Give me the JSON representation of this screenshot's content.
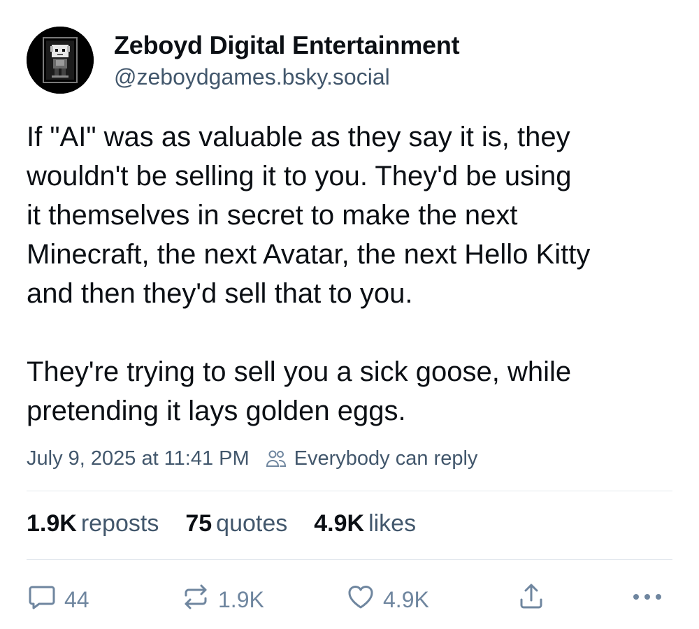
{
  "author": {
    "display_name": "Zeboyd Digital Entertainment",
    "handle": "@zeboydgames.bsky.social"
  },
  "post": {
    "paragraphs": [
      "If \"AI\" was as valuable as they say it is, they\nwouldn't be selling it to you. They'd be using\nit themselves in secret to make the next\nMinecraft, the next Avatar, the next Hello Kitty\nand then they'd sell that to you.",
      "They're trying to sell you a sick goose, while\npretending it lays golden eggs."
    ],
    "timestamp": "July 9, 2025 at 11:41 PM",
    "reply_setting": "Everybody can reply"
  },
  "stats": {
    "reposts_count": "1.9K",
    "reposts_label": "reposts",
    "quotes_count": "75",
    "quotes_label": "quotes",
    "likes_count": "4.9K",
    "likes_label": "likes"
  },
  "actions": {
    "reply_count": "44",
    "repost_count": "1.9K",
    "like_count": "4.9K"
  },
  "icons": {
    "reply": "speech-bubble-icon",
    "repost": "repost-arrows-icon",
    "like": "heart-icon",
    "share": "share-icon",
    "more": "ellipsis-icon",
    "reply_setting": "people-icon"
  },
  "colors": {
    "text": "#0b0f14",
    "muted": "#42576c",
    "icon": "#6f869f",
    "divider": "#e3e8ee"
  }
}
